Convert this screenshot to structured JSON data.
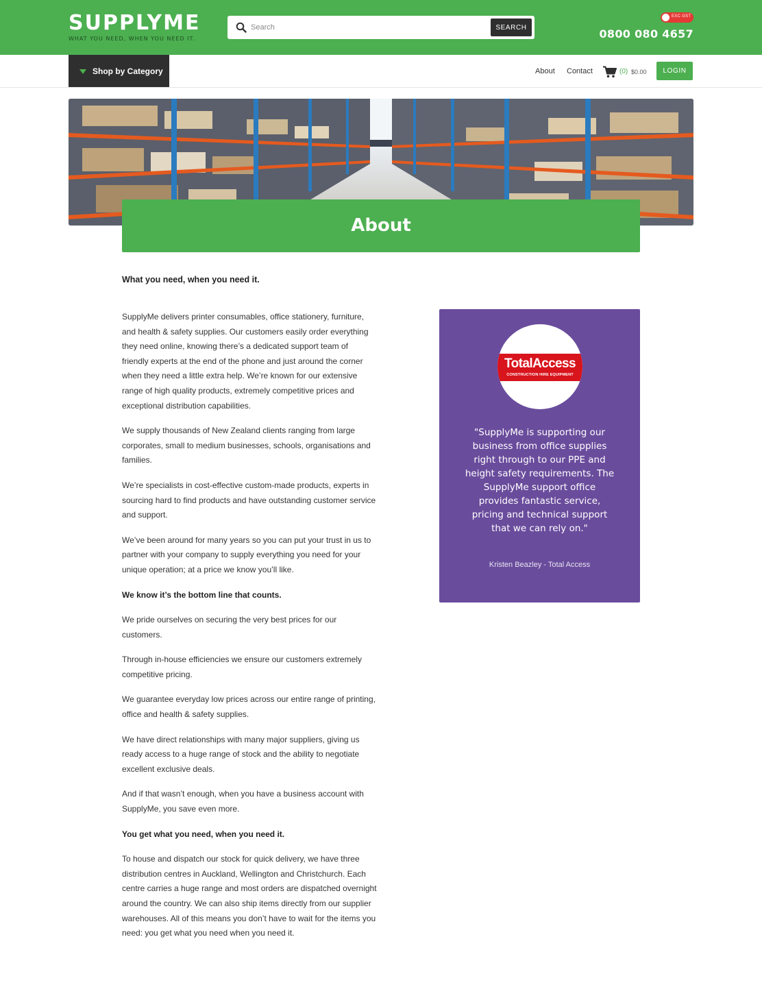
{
  "header": {
    "logo_text": "SUPPLYME",
    "logo_tagline": "WHAT YOU NEED, WHEN YOU NEED IT.",
    "search_placeholder": "Search",
    "search_button": "SEARCH",
    "gst_toggle_label": "EXC GST",
    "phone": "0800 080 4657"
  },
  "nav": {
    "shop_by_category": "Shop by Category",
    "about": "About",
    "contact": "Contact",
    "cart_count": "(0)",
    "cart_total": "$0.00",
    "login": "LOGIN"
  },
  "page": {
    "title": "About",
    "intro_heading": "What you need, when you need it.",
    "paragraphs": [
      "SupplyMe delivers printer consumables, office stationery, furniture, and health & safety supplies. Our customers easily order everything they need online, knowing there’s a dedicated support team of friendly experts at the end of the phone and just around the corner when they need a little extra help. We’re known for our extensive range of high quality products, extremely competitive prices and exceptional distribution capabilities.",
      "We supply thousands of New Zealand clients ranging from large corporates, small to medium businesses, schools, organisations and families.",
      "We’re specialists in cost-effective custom-made products, experts in sourcing hard to find products and have outstanding customer service and support.",
      "We’ve been around for many years so you can put your trust in us to partner with your company to supply everything you need for your unique operation; at a price we know you’ll like.",
      "We know it’s the bottom line that counts.",
      "We pride ourselves on securing the very best prices for our customers.",
      "Through in-house efficiencies we ensure our customers extremely competitive pricing.",
      "We guarantee everyday low prices across our entire range of printing, office and health & safety supplies.",
      "We have direct relationships with many major suppliers, giving us ready access to a huge range of stock and the ability to negotiate excellent exclusive deals.",
      "And if that wasn’t enough, when you have a business account with SupplyMe, you save even more.",
      "You get what you need, when you need it.",
      "To house and dispatch our stock for quick delivery, we have three distribution centres in Auckland, Wellington and Christchurch. Each centre carries a huge range and most orders are dispatched overnight around the country. We can also ship items directly from our supplier warehouses. All of this means you don’t have to wait for the items you need: you get what you need when you need it."
    ]
  },
  "testimonial": {
    "logo_main": "TotalAccess",
    "logo_sub": "CONSTRUCTION HIRE EQUIPMENT",
    "quote": "\"SupplyMe is supporting our business from office supplies right through to our PPE and height safety requirements. The SupplyMe support office provides fantastic service, pricing and technical support that we can rely on.\"",
    "author": "Kristen Beazley - Total Access"
  },
  "colors": {
    "brand_green": "#4caf50",
    "dark": "#2f2f2f",
    "testimonial_purple": "#6a4c9c",
    "gst_red": "#e53935"
  },
  "icons": [
    "search-icon",
    "dropdown-triangle-icon",
    "cart-icon",
    "toggle-knob-icon"
  ]
}
